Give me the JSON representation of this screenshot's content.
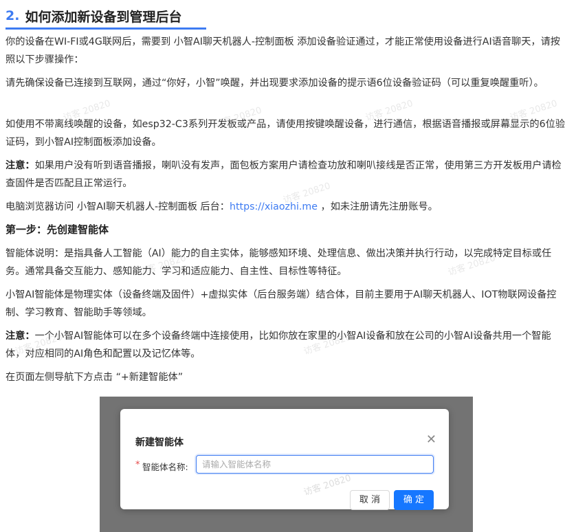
{
  "heading": {
    "number": "2.",
    "title": "如何添加新设备到管理后台"
  },
  "paragraphs": {
    "p1": "你的设备在WI-FI或4G联网后，需要到 小智AI聊天机器人-控制面板 添加设备验证通过，才能正常使用设备进行AI语音聊天，请按照以下步骤操作：",
    "p2": "请先确保设备已连接到互联网，通过“你好，小智”唤醒，并出现要求添加设备的提示语6位设备验证码（可以重复唤醒重听）。",
    "p3": "如使用不带离线唤醒的设备，如esp32-C3系列开发板或产品，请使用按键唤醒设备，进行通信，根据语音播报或屏幕显示的6位验证码，到小智AI控制面板添加设备。",
    "p4_label": "注意：",
    "p4_text": "如果用户没有听到语音播报，喇叭没有发声，面包板方案用户请检查功放和喇叭接线是否正常，使用第三方开发板用户请检查固件是否匹配且正常运行。",
    "p5_prefix": "电脑浏览器访问 小智AI聊天机器人-控制面板 后台：",
    "p5_link": "https://xiaozhi.me",
    "p5_suffix": "，如未注册请先注册账号。",
    "step1": "第一步：先创建智能体",
    "p6": "智能体说明：是指具备人工智能（AI）能力的自主实体，能够感知环境、处理信息、做出决策并执行行动，以完成特定目标或任务。通常具备交互能力、感知能力、学习和适应能力、自主性、目标性等特征。",
    "p7": "小智AI智能体是物理实体（设备终端及固件）+虚拟实体（后台服务端）结合体，目前主要用于AI聊天机器人、IOT物联网设备控制、学习教育、智能助手等领域。",
    "p8_label": "注意：",
    "p8_text": "一个小智AI智能体可以在多个设备终端中连接使用，比如你放在家里的小智AI设备和放在公司的小智AI设备共用一个智能体，对应相同的AI角色和配置以及记忆体等。",
    "p9": "在页面左侧导航下方点击 “+新建智能体”"
  },
  "watermark": "访客 20820",
  "dialog": {
    "title": "新建智能体",
    "required_mark": "*",
    "field_label": "智能体名称:",
    "field_placeholder": "请输入智能体名称",
    "cancel_label": "取 消",
    "ok_label": "确 定"
  },
  "colors": {
    "accent": "#3d7bf2",
    "primary_button": "#1677ff",
    "required": "#e64a4a"
  }
}
